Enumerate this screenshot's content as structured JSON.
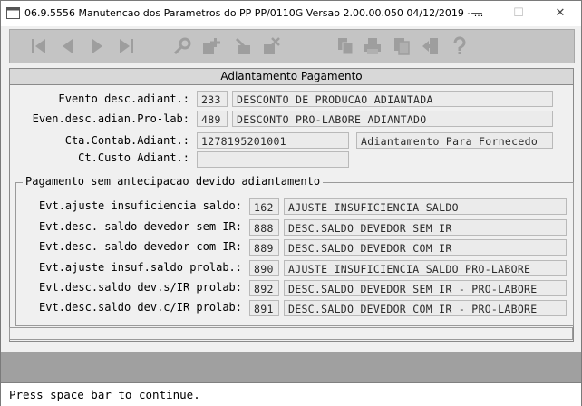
{
  "window": {
    "title": "06.9.5556 Manutencao dos  Parametros do PP PP/0110G Versao 2.00.00.050 04/12/2019 - ...",
    "minimize_glyph": "—",
    "maximize_glyph": "☐",
    "close_glyph": "✕"
  },
  "toolbar": {
    "icons": [
      "first-record-icon",
      "previous-record-icon",
      "next-record-icon",
      "last-record-icon",
      "search-icon",
      "add-icon",
      "edit-icon",
      "delete-icon",
      "open-document-icon",
      "print-icon",
      "copy-icon",
      "exit-icon",
      "help-icon"
    ]
  },
  "panel": {
    "title": "Adiantamento Pagamento"
  },
  "fields": {
    "evento": {
      "label": "Evento desc.adiant.:",
      "code": "233",
      "desc": "DESCONTO DE PRODUCAO ADIANTADA"
    },
    "even_prolab": {
      "label": "Even.desc.adian.Pro-lab:",
      "code": "489",
      "desc": "DESCONTO PRO-LABORE ADIANTADO"
    },
    "cta_contab": {
      "label": "Cta.Contab.Adiant.:",
      "code": "1278195201001",
      "desc": "Adiantamento Para Fornecedo"
    },
    "ct_custo": {
      "label": "Ct.Custo Adiant.:",
      "code": ""
    }
  },
  "group": {
    "title": "Pagamento sem antecipacao devido adiantamento",
    "rows": [
      {
        "label": "Evt.ajuste insuficiencia saldo:",
        "code": "162",
        "desc": "AJUSTE INSUFICIENCIA SALDO"
      },
      {
        "label": "Evt.desc. saldo devedor sem IR:",
        "code": "888",
        "desc": "DESC.SALDO DEVEDOR SEM IR"
      },
      {
        "label": "Evt.desc. saldo devedor com IR:",
        "code": "889",
        "desc": "DESC.SALDO DEVEDOR COM IR"
      },
      {
        "label": "Evt.ajuste insuf.saldo prolab.:",
        "code": "890",
        "desc": "AJUSTE INSUFICIENCIA SALDO PRO-LABORE"
      },
      {
        "label": "Evt.desc.saldo dev.s/IR prolab:",
        "code": "892",
        "desc": "DESC.SALDO DEVEDOR SEM IR - PRO-LABORE"
      },
      {
        "label": "Evt.desc.saldo dev.c/IR prolab:",
        "code": "891",
        "desc": "DESC.SALDO DEVEDOR COM IR - PRO-LABORE"
      }
    ]
  },
  "status": {
    "text": "Press space bar to continue."
  },
  "colors": {
    "toolbar_bg": "#c4c4c4",
    "panel_bg": "#f0f0f0",
    "field_bg": "#ebebeb",
    "greybar": "#a0a0a0"
  }
}
